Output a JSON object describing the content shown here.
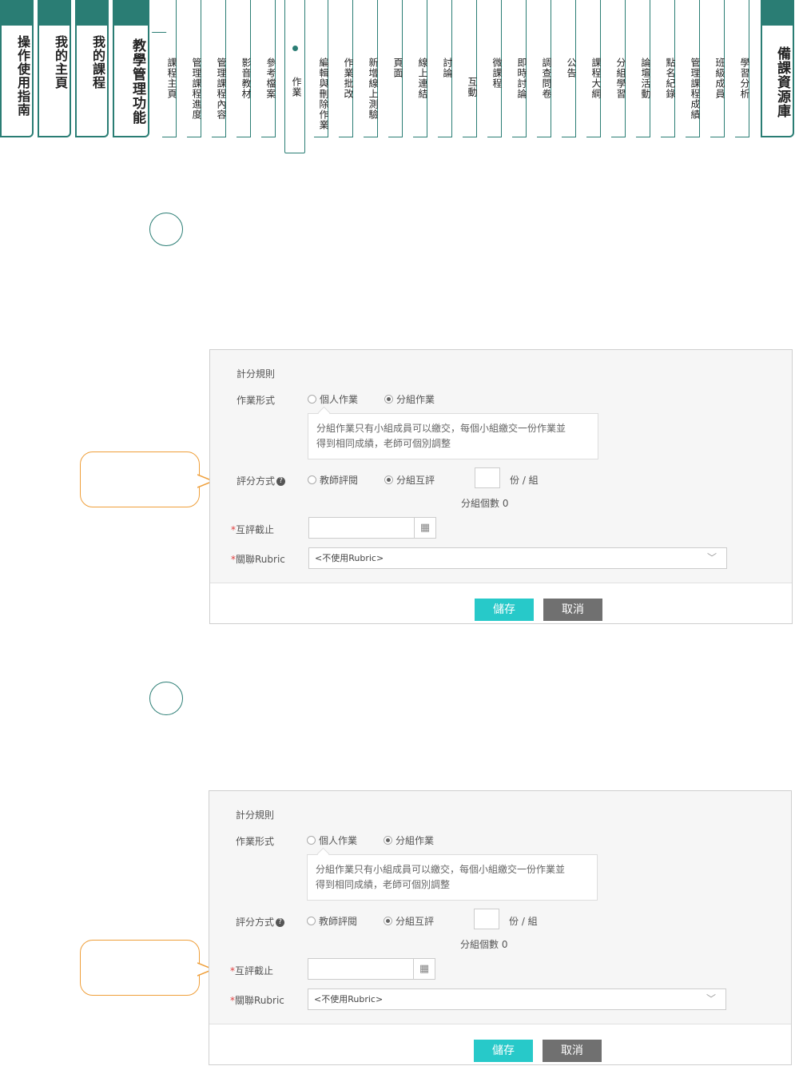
{
  "nav": {
    "main_tabs": [
      "操作使用指南",
      "我的主頁",
      "我的課程",
      "教學管理功能"
    ],
    "sub_tabs": [
      "課程主頁",
      "管理課程進度",
      "管理課程內容",
      "影音教材",
      "參考檔案",
      "作業",
      "編輯與刪除作業",
      "作業批改",
      "新增線上測驗",
      "頁面",
      "線上連結",
      "討論",
      "互動",
      "微課程",
      "即時討論",
      "調查問卷",
      "公告",
      "課程大綱",
      "分組學習",
      "論壇活動",
      "點名紀錄",
      "管理課程成績",
      "班級成員",
      "學習分析"
    ],
    "active_sub": "作業",
    "right_tab": "備課資源庫"
  },
  "panels": [
    {
      "section_title": "計分規則",
      "work_type_label": "作業形式",
      "work_type_options": [
        "個人作業",
        "分組作業"
      ],
      "work_type_selected": "分組作業",
      "note_line1": "分組作業只有小組成員可以繳交，每個小組繳交一份作業並",
      "note_line2": "得到相同成績，老師可個別調整",
      "grading_label": "評分方式",
      "grading_options": [
        "教師評閱",
        "分組互評"
      ],
      "grading_selected": "分組互評",
      "per_group_suffix": "份 / 組",
      "group_count": "分組個數 0",
      "peer_deadline_label": "互評截止",
      "rubric_label": "關聯Rubric",
      "rubric_value": "<不使用Rubric>",
      "save": "儲存",
      "cancel": "取消",
      "callout_target": "評分方式"
    },
    {
      "section_title": "計分規則",
      "work_type_label": "作業形式",
      "work_type_options": [
        "個人作業",
        "分組作業"
      ],
      "work_type_selected": "分組作業",
      "note_line1": "分組作業只有小組成員可以繳交，每個小組繳交一份作業並",
      "note_line2": "得到相同成績，老師可個別調整",
      "grading_label": "評分方式",
      "grading_options": [
        "教師評閱",
        "分組互評"
      ],
      "grading_selected": "分組互評",
      "per_group_suffix": "份 / 組",
      "group_count": "分組個數 0",
      "peer_deadline_label": "互評截止",
      "rubric_label": "關聯Rubric",
      "rubric_value": "<不使用Rubric>",
      "save": "儲存",
      "cancel": "取消",
      "callout_target": "互評截止"
    }
  ],
  "colors": {
    "accent": "#2a7d74",
    "save": "#27c9c9",
    "cancel": "#707070",
    "callout": "#ef9f3a"
  }
}
